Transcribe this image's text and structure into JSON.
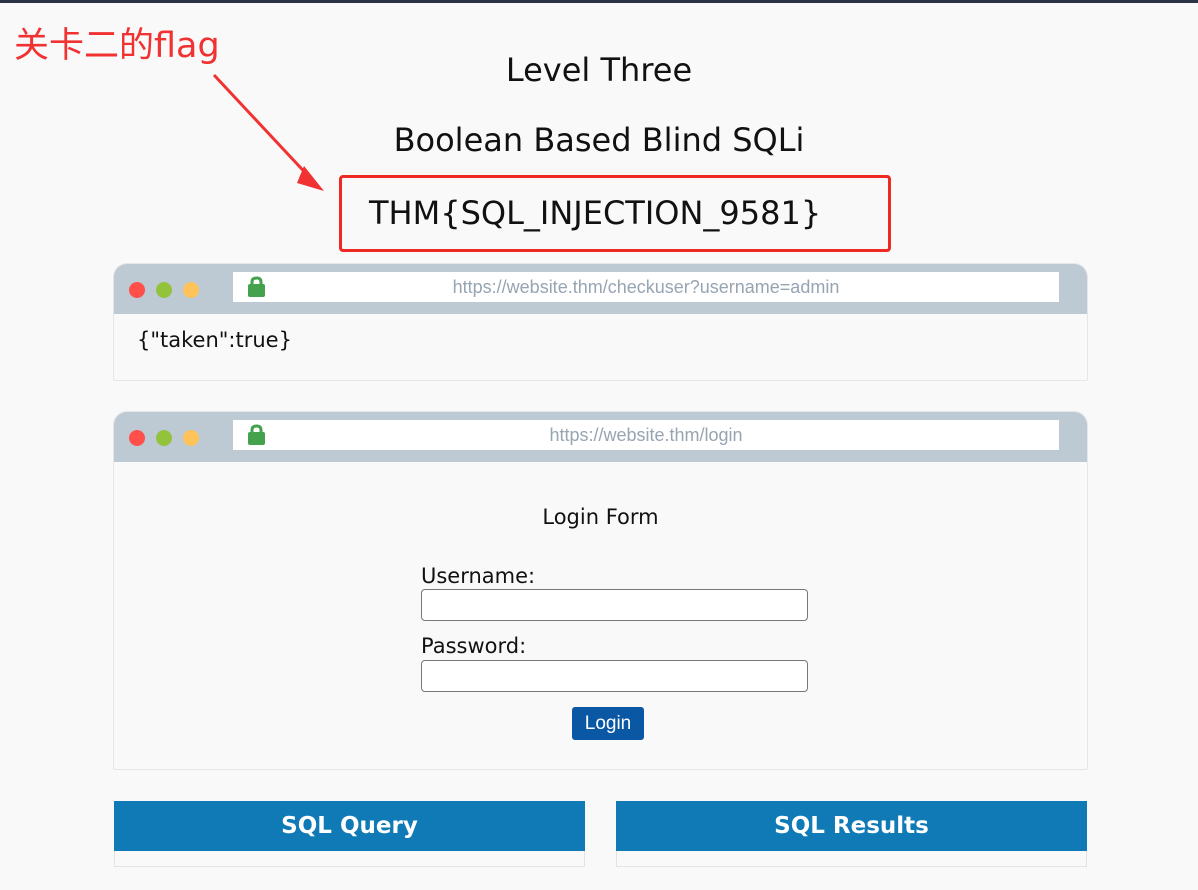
{
  "annotation": {
    "label": "关卡二的flag",
    "color": "#f03232"
  },
  "page": {
    "title": "Level Three",
    "subtitle": "Boolean Based Blind SQLi",
    "flag": "THM{SQL_INJECTION_9581}"
  },
  "browser_check": {
    "url": "https://website.thm/checkuser?username=admin",
    "response": "{\"taken\":true}"
  },
  "browser_login": {
    "url": "https://website.thm/login",
    "form_title": "Login Form",
    "username_label": "Username:",
    "username_value": "",
    "password_label": "Password:",
    "password_value": "",
    "button_label": "Login"
  },
  "panels": {
    "query_title": "SQL Query",
    "results_title": "SQL Results"
  },
  "colors": {
    "flag_border": "#ee2a24",
    "browser_bar": "#bdc9d3",
    "panel_header": "#0f7ab6",
    "button": "#0a57a4"
  },
  "icons": {
    "lock": "lock-icon",
    "window_dots": [
      "red",
      "green",
      "yellow"
    ]
  }
}
